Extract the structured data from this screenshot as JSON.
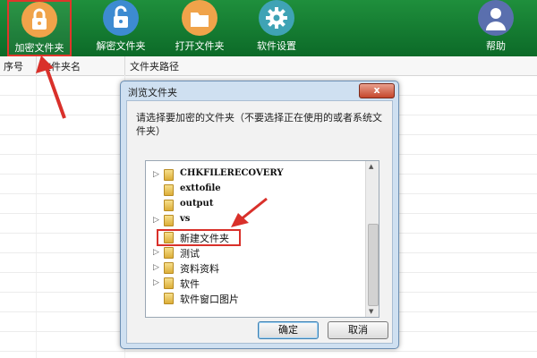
{
  "toolbar": {
    "items": [
      {
        "label": "加密文件夹",
        "icon": "padlock-closed-icon",
        "color": "#f0a34a"
      },
      {
        "label": "解密文件夹",
        "icon": "padlock-open-icon",
        "color": "#3d8bd1"
      },
      {
        "label": "打开文件夹",
        "icon": "folder-icon",
        "color": "#f0a34a"
      },
      {
        "label": "软件设置",
        "icon": "gear-icon",
        "color": "#3fa3b5"
      },
      {
        "label": "帮助",
        "icon": "help-person-icon",
        "color": "#5a6fae"
      }
    ]
  },
  "list": {
    "columns": [
      "序号",
      "文件夹名",
      "文件夹路径"
    ]
  },
  "dialog": {
    "title": "浏览文件夹",
    "close_label": "x",
    "instruction": "请选择要加密的文件夹（不要选择正在使用的或者系统文件夹）",
    "folders": [
      {
        "name": "CHKFILERECOVERY",
        "expander": "▷"
      },
      {
        "name": "exttofile",
        "expander": ""
      },
      {
        "name": "output",
        "expander": ""
      },
      {
        "name": "vs",
        "expander": "▷"
      },
      {
        "name": "新建文件夹",
        "expander": ""
      },
      {
        "name": "测试",
        "expander": "▷"
      },
      {
        "name": "资料资料",
        "expander": "▷"
      },
      {
        "name": "软件",
        "expander": "▷"
      },
      {
        "name": "软件窗口图片",
        "expander": ""
      }
    ],
    "ok_label": "确定",
    "cancel_label": "取消"
  },
  "colors": {
    "toolbar_green": "#157a31",
    "annotation_red": "#d9302a"
  }
}
